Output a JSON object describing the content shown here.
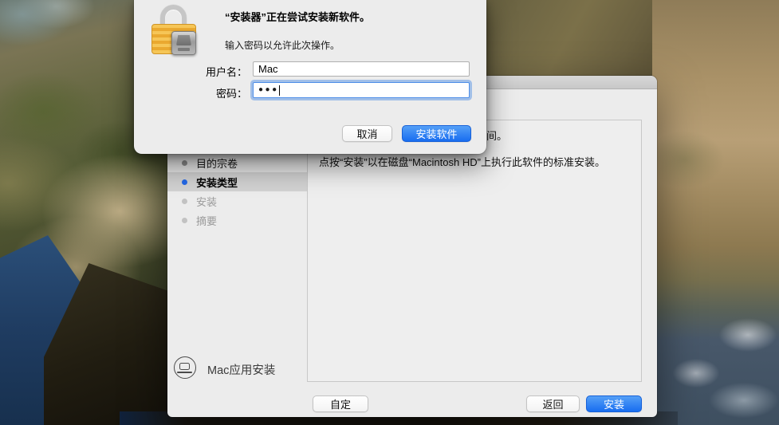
{
  "auth": {
    "title": "“安装器”正在尝试安装新软件。",
    "subtitle": "输入密码以允许此次操作。",
    "username_label": "用户名：",
    "username_value": "Mac",
    "password_label": "密码：",
    "password_masked": "●●●",
    "cancel_label": "取消",
    "install_software_label": "安装软件"
  },
  "installer": {
    "sidebar": {
      "items": [
        {
          "label": "目的宗卷",
          "state": "done"
        },
        {
          "label": "安装类型",
          "state": "current"
        },
        {
          "label": "安装",
          "state": "pending"
        },
        {
          "label": "摘要",
          "state": "pending"
        }
      ]
    },
    "content": {
      "space_note_tail": "间。",
      "instruction": "点按“安装”以在磁盘“Macintosh HD”上执行此软件的标准安装。"
    },
    "footer": {
      "product_label": "Mac应用安装",
      "customize_label": "自定",
      "back_label": "返回",
      "install_label": "安装"
    }
  },
  "colors": {
    "accent_blue": "#2878f4",
    "selection_gray": "#d2d2d2",
    "window_bg": "#ececec"
  }
}
